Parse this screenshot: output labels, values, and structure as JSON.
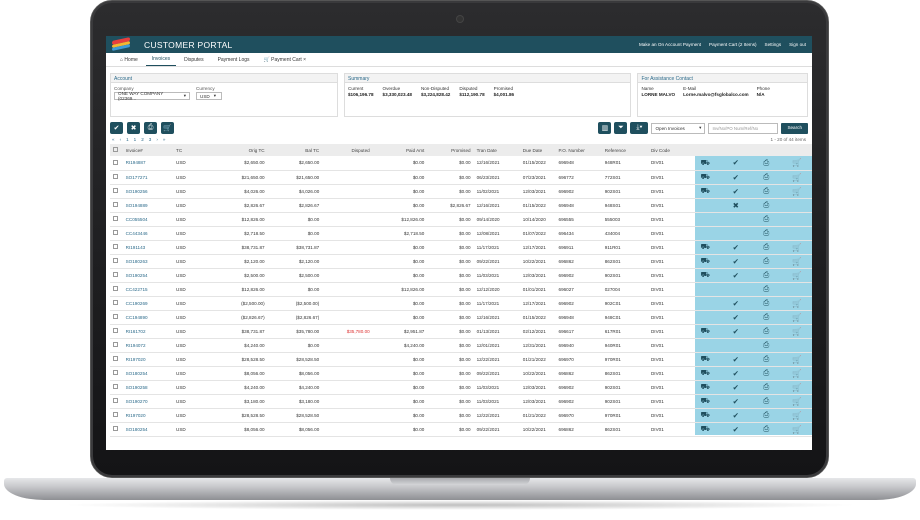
{
  "header": {
    "title": "CUSTOMER PORTAL",
    "links": [
      "Make an On Account Payment",
      "Payment Cart (2 Items)",
      "Settings",
      "Sign out"
    ]
  },
  "tabs": [
    {
      "label": "Home"
    },
    {
      "label": "Invoices"
    },
    {
      "label": "Disputes"
    },
    {
      "label": "Payment Logs"
    },
    {
      "label": "Payment Cart"
    }
  ],
  "account": {
    "heading": "Account",
    "company_label": "Company",
    "company_value": "ONE WAY COMPANY (02369...",
    "currency_label": "Currency",
    "currency_value": "USD"
  },
  "summary": {
    "heading": "Summary",
    "cols": [
      {
        "label": "Current",
        "value": "$106,196.78"
      },
      {
        "label": "Overdue",
        "value": "$3,330,023.48"
      },
      {
        "label": "Non-Disputed",
        "value": "$3,224,828.42"
      },
      {
        "label": "Disputed",
        "value": "$112,190.78"
      },
      {
        "label": "Promised",
        "value": "$4,001.86"
      }
    ]
  },
  "contact": {
    "heading": "For Assistance Contact",
    "name_label": "Name",
    "name_value": "LORNE MALVO",
    "email_label": "E-Mail",
    "email_value": "Lorne.malvo@fsglobalco.com",
    "phone_label": "Phone",
    "phone_value": "N/A"
  },
  "toolbar": {
    "filter_select": "Open Invoices",
    "search_placeholder": "Inv/No/PO Num/Ref/No",
    "search_label": "Search",
    "count_text": "1 - 20 of 44 items"
  },
  "pager": [
    "«",
    "‹",
    "1",
    "1",
    "2",
    "3",
    "›",
    "»"
  ],
  "table": {
    "columns": [
      "Invoice#",
      "TC",
      "Orig TC",
      "Bal TC",
      "Disputed",
      "Paid Amt",
      "Promised",
      "Tran Date",
      "Due Date",
      "P.O. Number",
      "Reference",
      "Div Code"
    ],
    "rows": [
      [
        "RI194887",
        "USD",
        "$2,650.00",
        "$2,650.00",
        "",
        "$0.00",
        "$0.00",
        "12/16/2021",
        "01/15/2022",
        "696948",
        "948R01",
        "DIV01"
      ],
      [
        "SO177271",
        "USD",
        "$21,650.00",
        "$21,650.00",
        "",
        "$0.00",
        "$0.00",
        "06/23/2021",
        "07/23/2021",
        "696772",
        "772S01",
        "DIV01"
      ],
      [
        "SO190256",
        "USD",
        "$4,026.00",
        "$4,026.00",
        "",
        "$0.00",
        "$0.00",
        "11/02/2021",
        "12/03/2021",
        "696902",
        "902S01",
        "DIV01"
      ],
      [
        "SO194889",
        "USD",
        "$2,826.67",
        "$2,826.67",
        "",
        "$0.00",
        "$2,826.67",
        "12/16/2021",
        "01/15/2022",
        "696948",
        "948S01",
        "DIV01"
      ],
      [
        "CC055504",
        "USD",
        "$12,826.00",
        "$0.00",
        "",
        "$12,826.00",
        "$0.00",
        "09/14/2020",
        "10/14/2020",
        "696555",
        "555003",
        "DIV01"
      ],
      [
        "CC443446",
        "USD",
        "$2,718.50",
        "$0.00",
        "",
        "$2,718.50",
        "$0.00",
        "12/08/2021",
        "01/07/2022",
        "696434",
        "434004",
        "DIV01"
      ],
      [
        "RI191143",
        "USD",
        "$38,731.87",
        "$38,731.87",
        "",
        "$0.00",
        "$0.00",
        "11/17/2021",
        "12/17/2021",
        "696911",
        "911R01",
        "DIV01"
      ],
      [
        "SO180263",
        "USD",
        "$2,120.00",
        "$2,120.00",
        "",
        "$0.00",
        "$0.00",
        "09/22/2021",
        "10/22/2021",
        "696862",
        "862S01",
        "DIV01"
      ],
      [
        "SO190254",
        "USD",
        "$2,500.00",
        "$2,500.00",
        "",
        "$0.00",
        "$0.00",
        "11/03/2021",
        "12/03/2021",
        "696902",
        "902S01",
        "DIV01"
      ],
      [
        "CC422715",
        "USD",
        "$12,826.00",
        "$0.00",
        "",
        "$12,826.00",
        "$0.00",
        "12/12/2020",
        "01/01/2021",
        "696027",
        "027004",
        "DIV01"
      ],
      [
        "CC190269",
        "USD",
        "($2,500.00)",
        "($2,500.00)",
        "",
        "$0.00",
        "$0.00",
        "11/17/2021",
        "12/17/2021",
        "696902",
        "902C01",
        "DIV01"
      ],
      [
        "CC194890",
        "USD",
        "($2,826.67)",
        "($2,826.67)",
        "",
        "$0.00",
        "$0.00",
        "12/16/2021",
        "01/15/2022",
        "696948",
        "948C01",
        "DIV01"
      ],
      [
        "RI161702",
        "USD",
        "$38,731.87",
        "$35,780.00",
        "$35,780.00",
        "$2,951.87",
        "$0.00",
        "01/13/2021",
        "02/12/2021",
        "696617",
        "617R01",
        "DIV01"
      ],
      [
        "RI194072",
        "USD",
        "$4,240.00",
        "$0.00",
        "",
        "$4,240.00",
        "$0.00",
        "12/01/2021",
        "12/31/2021",
        "696940",
        "940R01",
        "DIV01"
      ],
      [
        "RI197020",
        "USD",
        "$28,528.50",
        "$28,528.50",
        "",
        "$0.00",
        "$0.00",
        "12/22/2021",
        "01/21/2022",
        "696970",
        "970R01",
        "DIV01"
      ],
      [
        "SO180254",
        "USD",
        "$8,056.00",
        "$8,056.00",
        "",
        "$0.00",
        "$0.00",
        "09/22/2021",
        "10/22/2021",
        "696862",
        "862S01",
        "DIV01"
      ],
      [
        "SO190258",
        "USD",
        "$4,240.00",
        "$4,240.00",
        "",
        "$0.00",
        "$0.00",
        "11/03/2021",
        "12/03/2021",
        "696902",
        "902S01",
        "DIV01"
      ],
      [
        "SO190270",
        "USD",
        "$3,180.00",
        "$3,180.00",
        "",
        "$0.00",
        "$0.00",
        "11/03/2021",
        "12/03/2021",
        "696902",
        "902S01",
        "DIV01"
      ],
      [
        "RI197020",
        "USD",
        "$28,528.50",
        "$28,528.50",
        "",
        "$0.00",
        "$0.00",
        "12/22/2021",
        "01/21/2022",
        "696970",
        "970R01",
        "DIV01"
      ],
      [
        "SO180254",
        "USD",
        "$8,056.00",
        "$8,056.00",
        "",
        "$0.00",
        "$0.00",
        "09/22/2021",
        "10/22/2021",
        "696862",
        "862S01",
        "DIV01"
      ]
    ],
    "actions": [
      [
        "truck",
        "check",
        "print",
        "cart"
      ],
      [
        "truck",
        "check",
        "print",
        "cart"
      ],
      [
        "truck",
        "check",
        "print",
        "cart"
      ],
      [
        "",
        "x",
        "print",
        ""
      ],
      [
        "",
        "",
        "print",
        ""
      ],
      [
        "",
        "",
        "print",
        ""
      ],
      [
        "truck",
        "check",
        "print",
        "cart"
      ],
      [
        "truck",
        "check",
        "print",
        "cart"
      ],
      [
        "truck",
        "check",
        "print",
        "cart"
      ],
      [
        "",
        "",
        "print",
        ""
      ],
      [
        "",
        "check",
        "print",
        "cart"
      ],
      [
        "",
        "check",
        "print",
        "cart"
      ],
      [
        "truck",
        "check",
        "print",
        "cart"
      ],
      [
        "",
        "",
        "print",
        ""
      ],
      [
        "truck",
        "check",
        "print",
        "cart"
      ],
      [
        "truck",
        "check",
        "print",
        "cart"
      ],
      [
        "truck",
        "check",
        "print",
        "cart"
      ],
      [
        "truck",
        "check",
        "print",
        "cart"
      ],
      [
        "truck",
        "check",
        "print",
        "cart"
      ],
      [
        "truck",
        "check",
        "print",
        "cart"
      ]
    ]
  },
  "icons": {
    "check": "✔",
    "x": "✖",
    "print": "⎙",
    "cart": "🛒",
    "truck": "⛟"
  },
  "colors": {
    "header": "#1f4f5e",
    "action_bg": "#9ad4e6",
    "link": "#2b6a8a",
    "disputed": "#d33"
  }
}
